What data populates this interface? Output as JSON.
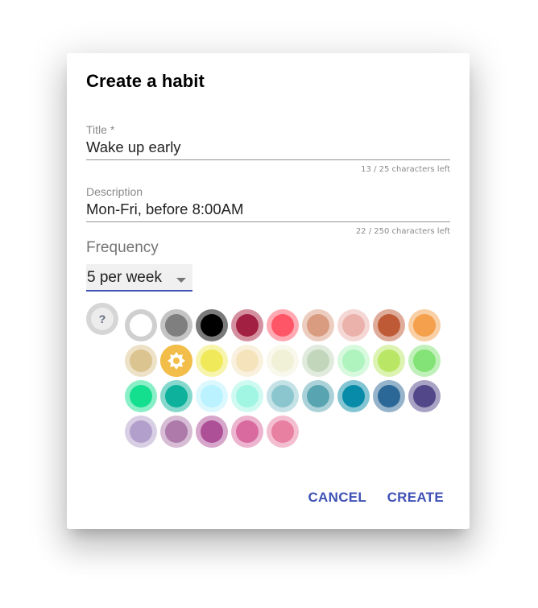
{
  "dialog": {
    "title": "Create a habit",
    "fields": {
      "title": {
        "label": "Title *",
        "value": "Wake up early",
        "helper": "13 / 25 characters left"
      },
      "description": {
        "label": "Description",
        "value": "Mon-Fri, before 8:00AM",
        "helper": "22 / 250 characters left"
      }
    },
    "frequency": {
      "label": "Frequency",
      "selected": "5 per week"
    },
    "help_button": {
      "icon": "question-icon",
      "glyph": "?"
    },
    "colors": {
      "selected_index": 10,
      "selected_icon": "sun-icon",
      "swatches": [
        {
          "core": "#ffffff",
          "ring": "#cfcfcf"
        },
        {
          "core": "#7f7f7f",
          "ring": "#c4c4c4"
        },
        {
          "core": "#000000",
          "ring": "#7a7a7a"
        },
        {
          "core": "#a22041",
          "ring": "#d4909f"
        },
        {
          "core": "#ff5667",
          "ring": "#ffaab3"
        },
        {
          "core": "#d99c80",
          "ring": "#eccdbf"
        },
        {
          "core": "#ebb1ab",
          "ring": "#f5d8d5"
        },
        {
          "core": "#bf5a36",
          "ring": "#dfac9a"
        },
        {
          "core": "#f4a04c",
          "ring": "#f9cfa5"
        },
        {
          "core": "#dbc48f",
          "ring": "#ede2c7"
        },
        {
          "core": "#f2bd48",
          "ring": "#f2bd48"
        },
        {
          "core": "#f0e95a",
          "ring": "#f7f4ac"
        },
        {
          "core": "#f4e3bb",
          "ring": "#f9f1dd"
        },
        {
          "core": "#f1f1d8",
          "ring": "#f8f8ec"
        },
        {
          "core": "#c2d6bb",
          "ring": "#e0eadd"
        },
        {
          "core": "#aff3be",
          "ring": "#d7f9de"
        },
        {
          "core": "#b9e765",
          "ring": "#dcf3b2"
        },
        {
          "core": "#83e376",
          "ring": "#c1f1ba"
        },
        {
          "core": "#14df8f",
          "ring": "#89efc7"
        },
        {
          "core": "#0eb29c",
          "ring": "#86d8cd"
        },
        {
          "core": "#baf2ff",
          "ring": "#dcf8ff"
        },
        {
          "core": "#a0f5e3",
          "ring": "#cffaf1"
        },
        {
          "core": "#8bc6cf",
          "ring": "#c5e2e7"
        },
        {
          "core": "#58a5b1",
          "ring": "#abd2d8"
        },
        {
          "core": "#078ba8",
          "ring": "#83c5d3"
        },
        {
          "core": "#2b6898",
          "ring": "#95b3cb"
        },
        {
          "core": "#524789",
          "ring": "#a8a3c4"
        },
        {
          "core": "#b29fcc",
          "ring": "#d8cfe5"
        },
        {
          "core": "#ae7aaa",
          "ring": "#d6bcd4"
        },
        {
          "core": "#ae5098",
          "ring": "#d6a7cb"
        },
        {
          "core": "#d96a9f",
          "ring": "#ecb4cf"
        },
        {
          "core": "#e880a2",
          "ring": "#f3bfd0"
        }
      ]
    },
    "actions": {
      "cancel_label": "CANCEL",
      "create_label": "CREATE"
    },
    "accent_color": "#3f51b5"
  }
}
